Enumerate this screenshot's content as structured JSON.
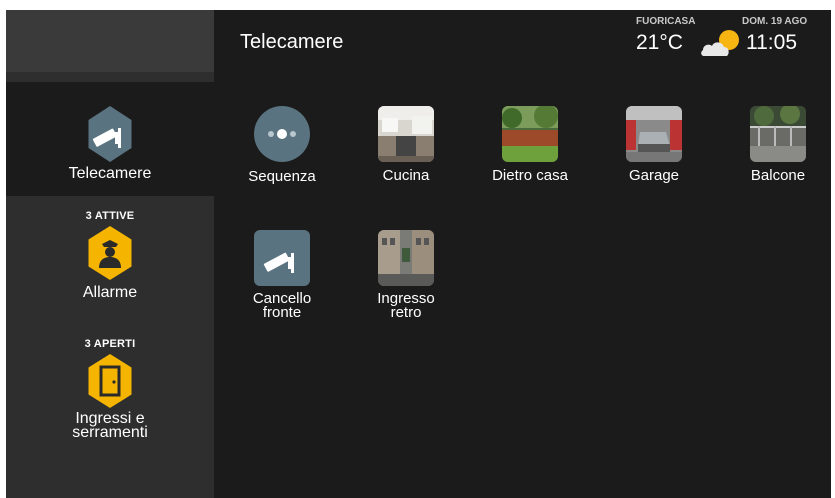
{
  "header": {
    "title": "Telecamere",
    "weather": {
      "label": "FUORICASA",
      "temperature": "21°C",
      "icon": "partly-cloudy-icon"
    },
    "clock": {
      "date": "DOM. 19 AGO",
      "time": "11:05"
    }
  },
  "sidebar": {
    "items": [
      {
        "label": "Telecamere",
        "icon": "camera-icon",
        "active": true
      },
      {
        "count": "3 ATTIVE",
        "label": "Allarme",
        "icon": "guard-icon",
        "color": "#f5b400"
      },
      {
        "count": "3 APERTI",
        "label_line1": "Ingressi e",
        "label_line2": "serramenti",
        "icon": "door-icon",
        "color": "#f5b400"
      }
    ]
  },
  "cameras": [
    {
      "label": "Sequenza",
      "icon": "sequence-icon"
    },
    {
      "label": "Cucina",
      "icon": "kitchen-thumbnail"
    },
    {
      "label": "Dietro casa",
      "icon": "backyard-thumbnail"
    },
    {
      "label": "Garage",
      "icon": "garage-thumbnail"
    },
    {
      "label": "Balcone",
      "icon": "balcony-thumbnail"
    },
    {
      "label_line1": "Cancello",
      "label_line2": "fronte",
      "icon": "camera-icon"
    },
    {
      "label_line1": "Ingresso",
      "label_line2": "retro",
      "icon": "street-thumbnail"
    }
  ],
  "colors": {
    "background": "#1b1b1b",
    "sidebar": "#2e2e2e",
    "accent": "#f5b400",
    "icon_bg": "#5a7380"
  }
}
